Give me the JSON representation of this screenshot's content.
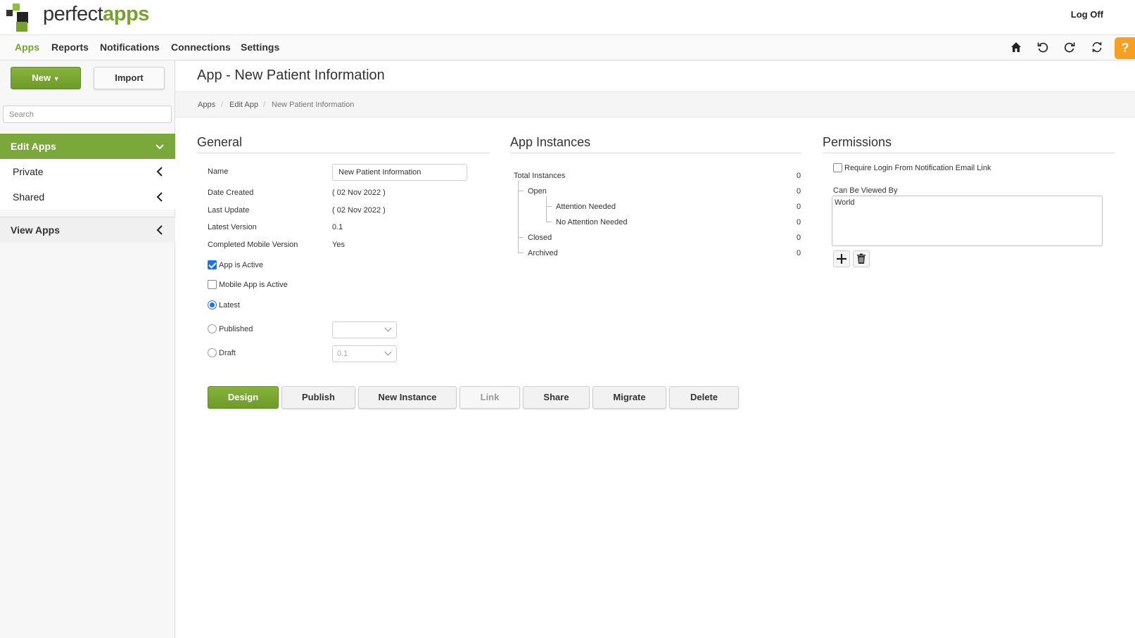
{
  "app": {
    "brand_part1": "perfect",
    "brand_part2": "apps",
    "logoff_label": "Log Off"
  },
  "nav": {
    "items": [
      {
        "label": "Apps",
        "active": true
      },
      {
        "label": "Reports"
      },
      {
        "label": "Notifications"
      },
      {
        "label": "Connections"
      },
      {
        "label": "Settings"
      }
    ],
    "icons": [
      "home-icon",
      "undo-icon",
      "redo-icon",
      "sync-icon"
    ],
    "help_label": "?"
  },
  "sidebar": {
    "new_label": "New",
    "import_label": "Import",
    "search_placeholder": "Search",
    "edit_apps_label": "Edit Apps",
    "private_label": "Private",
    "shared_label": "Shared",
    "view_apps_label": "View Apps"
  },
  "page": {
    "title": "App - New Patient Information",
    "breadcrumb": [
      "Apps",
      "Edit App",
      "New Patient Information"
    ]
  },
  "general": {
    "title": "General",
    "name_label": "Name",
    "name_value": "New Patient Information",
    "date_created_label": "Date Created",
    "date_created_value": "( 02 Nov 2022 )",
    "last_update_label": "Last Update",
    "last_update_value": "( 02 Nov 2022 )",
    "latest_version_label": "Latest Version",
    "latest_version_value": "0.1",
    "completed_mobile_label": "Completed Mobile Version",
    "completed_mobile_value": "Yes",
    "app_active_label": "App is Active",
    "app_active_checked": true,
    "mobile_active_label": "Mobile App is Active",
    "mobile_active_checked": false,
    "latest_label": "Latest",
    "published_label": "Published",
    "published_value": "",
    "draft_label": "Draft",
    "draft_value": "0.1"
  },
  "actions": [
    {
      "label": "Design",
      "primary": true
    },
    {
      "label": "Publish"
    },
    {
      "label": "New Instance"
    },
    {
      "label": "Link",
      "disabled": true
    },
    {
      "label": "Share"
    },
    {
      "label": "Migrate"
    },
    {
      "label": "Delete"
    }
  ],
  "instances": {
    "title": "App Instances",
    "total_label": "Total Instances",
    "total_value": "0",
    "open_label": "Open",
    "open_value": "0",
    "attention_label": "Attention Needed",
    "attention_value": "0",
    "no_attention_label": "No Attention Needed",
    "no_attention_value": "0",
    "closed_label": "Closed",
    "closed_value": "0",
    "archived_label": "Archived",
    "archived_value": "0"
  },
  "permissions": {
    "title": "Permissions",
    "require_login_label": "Require Login From Notification Email Link",
    "require_login_checked": false,
    "viewed_by_label": "Can Be Viewed By",
    "viewed_by_value": "World"
  },
  "colors": {
    "accent": "#7aa83a",
    "help": "#f5a020",
    "checkbox": "#1a73e8"
  }
}
